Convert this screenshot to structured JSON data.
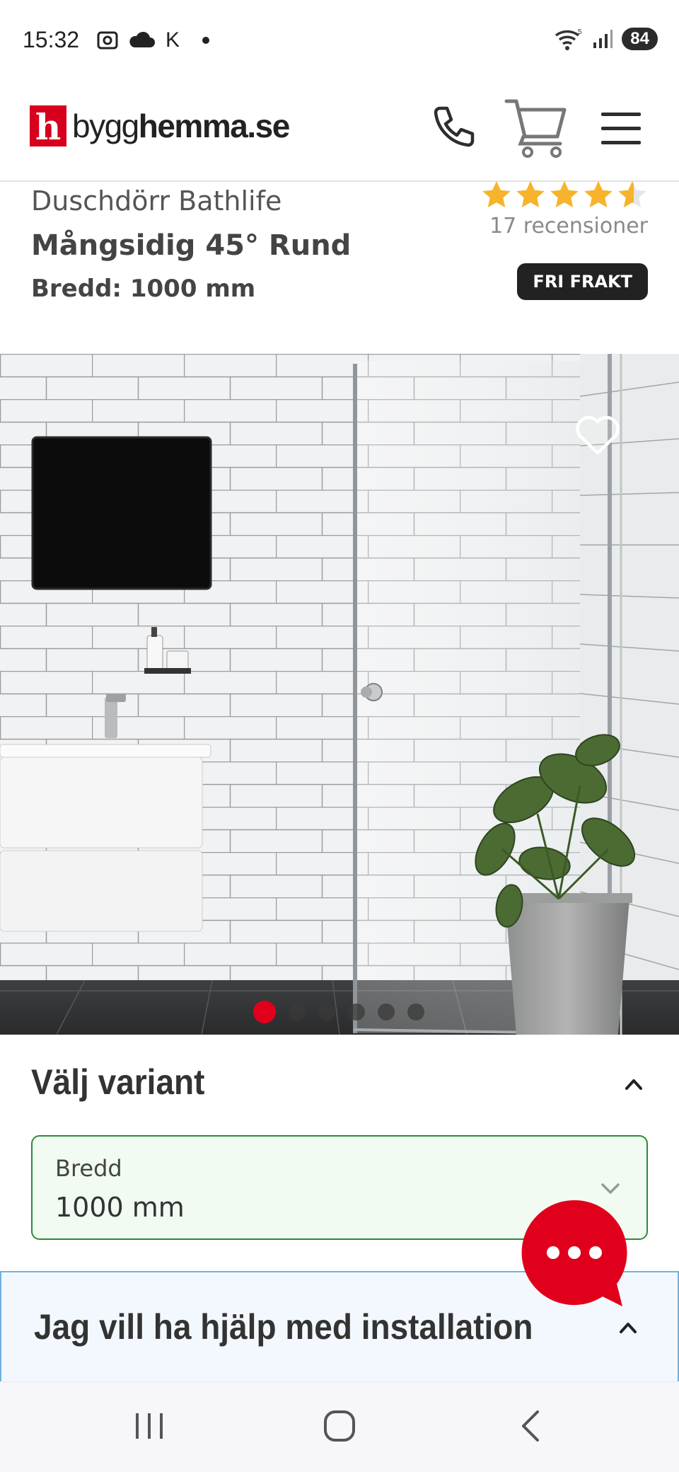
{
  "status_bar": {
    "time": "15:32",
    "letter": "K",
    "battery": "84"
  },
  "header": {
    "logo_mark": "h",
    "logo_text_regular": "bygg",
    "logo_text_bold": "hemma",
    "logo_text_suffix": ".se"
  },
  "product": {
    "brand": "Duschdörr Bathlife",
    "name": "Mångsidig 45° Rund",
    "width_label": "Bredd: 1000 mm",
    "rating": 4.6,
    "reviews": "17 recensioner",
    "badge": "FRI FRAKT"
  },
  "gallery": {
    "slide_count": 6,
    "active_index": 0
  },
  "variant": {
    "title": "Välj variant",
    "field_label": "Bredd",
    "field_value": "1000 mm"
  },
  "install": {
    "title": "Jag vill ha hjälp med installation"
  },
  "colors": {
    "brand_red": "#d6001c",
    "star": "#f7b32b",
    "select_border": "#2d8a3a",
    "install_border": "#6fb3de"
  }
}
